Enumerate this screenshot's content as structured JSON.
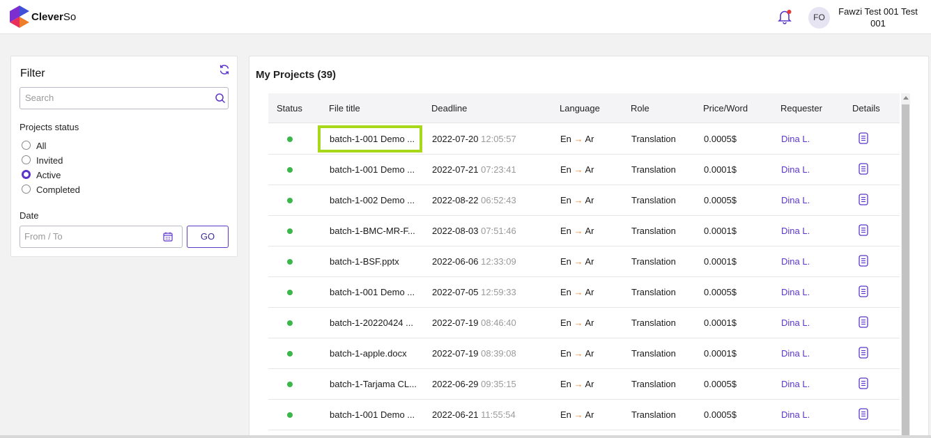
{
  "app": {
    "brand_main": "Clever",
    "brand_suffix": "So",
    "user_initials": "FO",
    "user_name": "Fawzi Test 001 Test 001"
  },
  "colors": {
    "accent": "#5b35c9",
    "status_active": "#3cb54a",
    "arrow": "#ef8a2d",
    "highlight": "#a8d81a"
  },
  "filter": {
    "title": "Filter",
    "search_placeholder": "Search",
    "status_label": "Projects status",
    "statuses": [
      {
        "label": "All",
        "checked": false
      },
      {
        "label": "Invited",
        "checked": false
      },
      {
        "label": "Active",
        "checked": true
      },
      {
        "label": "Completed",
        "checked": false
      }
    ],
    "date_label": "Date",
    "date_placeholder": "From / To",
    "go_label": "GO"
  },
  "projects": {
    "title": "My Projects (39)",
    "columns": {
      "status": "Status",
      "file_title": "File title",
      "deadline": "Deadline",
      "language": "Language",
      "role": "Role",
      "price": "Price/Word",
      "requester": "Requester",
      "details": "Details"
    },
    "rows": [
      {
        "file": "batch-1-001 Demo ...",
        "date": "2022-07-20",
        "time": "12:05:57",
        "src": "En",
        "arrow": "→",
        "tgt": "Ar",
        "role": "Translation",
        "price": "0.0005$",
        "requester": "Dina L."
      },
      {
        "file": "batch-1-001 Demo ...",
        "date": "2022-07-21",
        "time": "07:23:41",
        "src": "En",
        "arrow": "→",
        "tgt": "Ar",
        "role": "Translation",
        "price": "0.0001$",
        "requester": "Dina L."
      },
      {
        "file": "batch-1-002 Demo ...",
        "date": "2022-08-22",
        "time": "06:52:43",
        "src": "En",
        "arrow": "→",
        "tgt": "Ar",
        "role": "Translation",
        "price": "0.0005$",
        "requester": "Dina L."
      },
      {
        "file": "batch-1-BMC-MR-F...",
        "date": "2022-08-03",
        "time": "07:51:46",
        "src": "En",
        "arrow": "→",
        "tgt": "Ar",
        "role": "Translation",
        "price": "0.0001$",
        "requester": "Dina L."
      },
      {
        "file": "batch-1-BSF.pptx",
        "date": "2022-06-06",
        "time": "12:33:09",
        "src": "En",
        "arrow": "→",
        "tgt": "Ar",
        "role": "Translation",
        "price": "0.0001$",
        "requester": "Dina L."
      },
      {
        "file": "batch-1-001 Demo ...",
        "date": "2022-07-05",
        "time": "12:59:33",
        "src": "En",
        "arrow": "→",
        "tgt": "Ar",
        "role": "Translation",
        "price": "0.0005$",
        "requester": "Dina L."
      },
      {
        "file": "batch-1-20220424 ...",
        "date": "2022-07-19",
        "time": "08:46:40",
        "src": "En",
        "arrow": "→",
        "tgt": "Ar",
        "role": "Translation",
        "price": "0.0001$",
        "requester": "Dina L."
      },
      {
        "file": "batch-1-apple.docx",
        "date": "2022-07-19",
        "time": "08:39:08",
        "src": "En",
        "arrow": "→",
        "tgt": "Ar",
        "role": "Translation",
        "price": "0.0001$",
        "requester": "Dina L."
      },
      {
        "file": "batch-1-Tarjama CL...",
        "date": "2022-06-29",
        "time": "09:35:15",
        "src": "En",
        "arrow": "→",
        "tgt": "Ar",
        "role": "Translation",
        "price": "0.0005$",
        "requester": "Dina L."
      },
      {
        "file": "batch-1-001 Demo ...",
        "date": "2022-06-21",
        "time": "11:55:54",
        "src": "En",
        "arrow": "→",
        "tgt": "Ar",
        "role": "Translation",
        "price": "0.0005$",
        "requester": "Dina L."
      }
    ]
  }
}
